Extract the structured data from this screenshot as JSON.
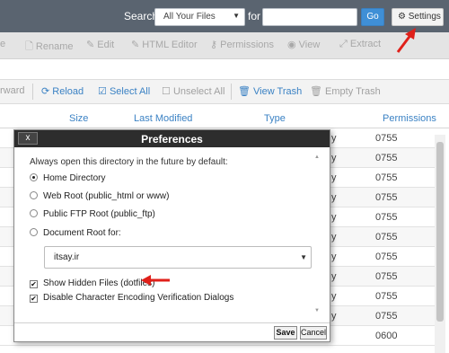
{
  "topbar": {
    "search_label": "Search",
    "scope_value": "All Your Files",
    "for_label": "for",
    "query_value": "",
    "go_label": "Go",
    "settings_label": "Settings"
  },
  "actions": {
    "items": [
      "e",
      "Rename",
      "Edit",
      "HTML Editor",
      "Permissions",
      "View",
      "Extract"
    ]
  },
  "nav": {
    "items": [
      "rward",
      "Reload",
      "Select All",
      "Unselect All",
      "View Trash",
      "Empty Trash"
    ]
  },
  "columns": [
    "Size",
    "Last Modified",
    "Type",
    "Permissions"
  ],
  "rows": [
    {
      "type_tail": "y",
      "perm": "0755"
    },
    {
      "type_tail": "y",
      "perm": "0755"
    },
    {
      "type_tail": "y",
      "perm": "0755"
    },
    {
      "type_tail": "y",
      "perm": "0755"
    },
    {
      "type_tail": "y",
      "perm": "0755"
    },
    {
      "type_tail": "y",
      "perm": "0755"
    },
    {
      "type_tail": "y",
      "perm": "0755"
    },
    {
      "type_tail": "y",
      "perm": "0755"
    },
    {
      "type_tail": "y",
      "perm": "0755"
    },
    {
      "type_tail": "y",
      "perm": "0755"
    },
    {
      "type_tail": "",
      "perm": "0600"
    }
  ],
  "dialog": {
    "close_label": "x",
    "title": "Preferences",
    "intro": "Always open this directory in the future by default:",
    "options": [
      "Home Directory",
      "Web Root (public_html or www)",
      "Public FTP Root (public_ftp)",
      "Document Root for:"
    ],
    "selected_option": "Home Directory",
    "docroot_value": "itsay.ir",
    "show_hidden_label": "Show Hidden Files (dotfiles)",
    "show_hidden_checked": true,
    "disable_encoding_label": "Disable Character Encoding Verification Dialogs",
    "disable_encoding_checked": true,
    "save_label": "Save",
    "cancel_label": "Cancel"
  },
  "colors": {
    "topbar_bg": "#5a6470",
    "link_blue": "#3b82c4",
    "go_button": "#3f8fd6",
    "dialog_title_bg": "#2d2d2d",
    "annotation_red": "#e0201a"
  }
}
